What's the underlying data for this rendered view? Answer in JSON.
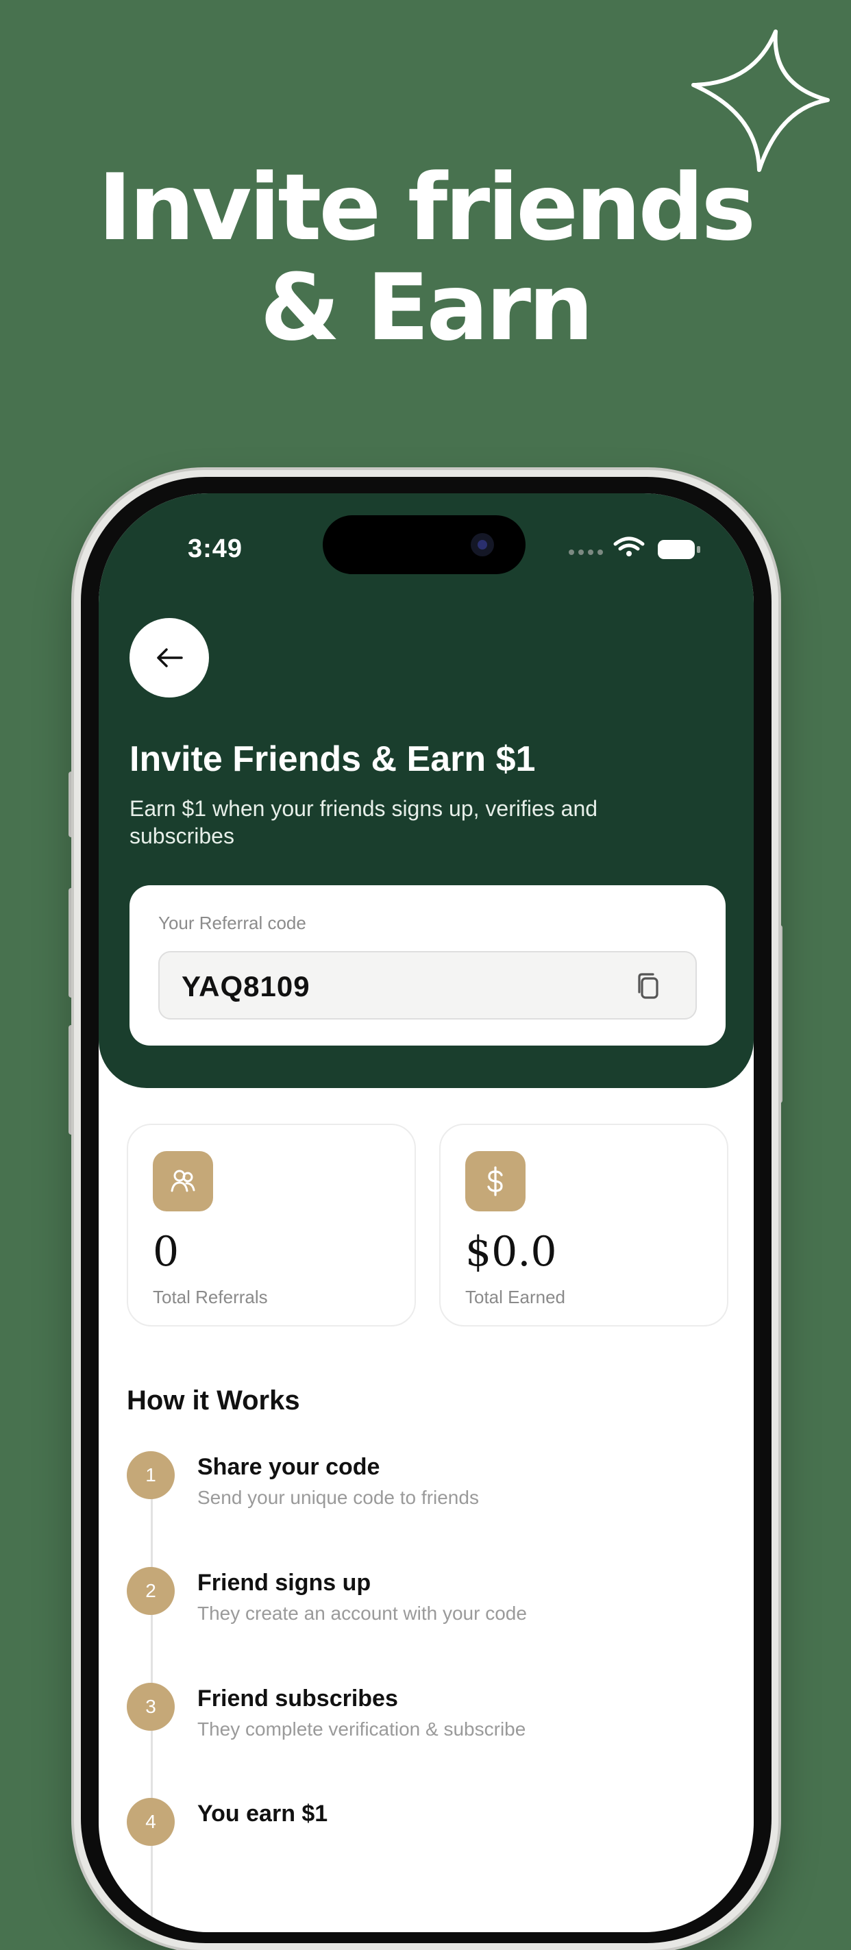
{
  "promo": {
    "headline_line1": "Invite friends",
    "headline_line2": "& Earn"
  },
  "status_bar": {
    "time": "3:49"
  },
  "screen": {
    "title": "Invite Friends & Earn $1",
    "subtitle": "Earn $1 when your friends signs up, verifies and subscribes",
    "referral": {
      "label": "Your Referral code",
      "code": "YAQ8109"
    },
    "stats": [
      {
        "icon": "users-icon",
        "value": "0",
        "label": "Total Referrals"
      },
      {
        "icon": "dollar-icon",
        "value": "$0.0",
        "label": "Total Earned"
      }
    ],
    "how_it_works": {
      "title": "How it Works",
      "steps": [
        {
          "num": "1",
          "title": "Share your code",
          "desc": "Send your unique code to friends"
        },
        {
          "num": "2",
          "title": "Friend signs up",
          "desc": "They create an account with your code"
        },
        {
          "num": "3",
          "title": "Friend subscribes",
          "desc": "They complete verification & subscribe"
        },
        {
          "num": "4",
          "title": "You earn $1",
          "desc": ""
        }
      ]
    }
  },
  "colors": {
    "background": "#48724f",
    "hero": "#1a3e2d",
    "accent": "#c5a878"
  }
}
